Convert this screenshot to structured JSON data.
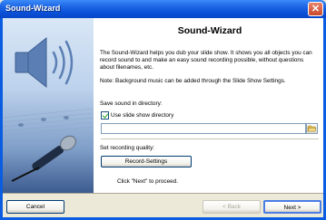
{
  "window": {
    "title": "Sound-Wizard",
    "close_glyph": "✕"
  },
  "main": {
    "heading": "Sound-Wizard",
    "description": "The Sound-Wizard helps you dub your slide show. It shows you all objects you can record sound to and make an easy sound recording possible, without questions about filenames, etc.",
    "note": "Note: Background music can be added through the Slide Show Settings.",
    "save_label": "Save sound in directory:",
    "checkbox_label": "Use slide show directory",
    "checkbox_checked": true,
    "directory_value": "",
    "quality_label": "Set recording quality:",
    "record_settings_label": "Record-Settings",
    "proceed_hint": "Click \"Next\" to proceed."
  },
  "footer": {
    "cancel_label": "Cancel",
    "back_label": "< Back",
    "next_label": "Next >"
  },
  "icons": {
    "banner": "speaker-icon",
    "browse": "folder-icon"
  }
}
